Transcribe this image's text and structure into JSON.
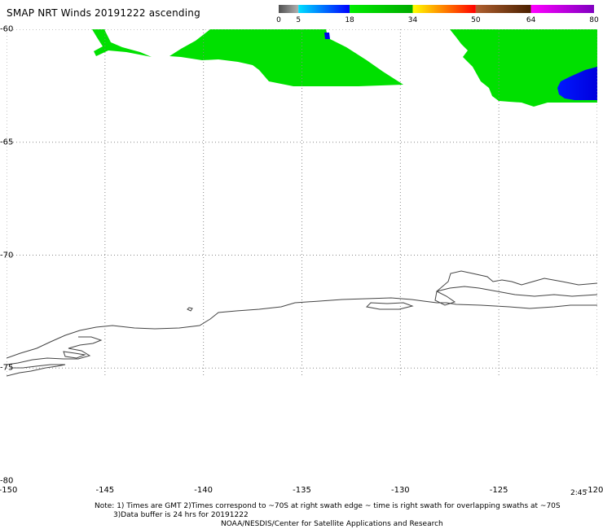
{
  "title": "SMAP NRT Winds 20191222 ascending",
  "legend": {
    "ticks": [
      {
        "label": "0",
        "value": 0
      },
      {
        "label": "5",
        "value": 5
      },
      {
        "label": "18",
        "value": 18
      },
      {
        "label": "34",
        "value": 34
      },
      {
        "label": "50",
        "value": 50
      },
      {
        "label": "64",
        "value": 64
      },
      {
        "label": "80",
        "value": 80
      }
    ],
    "bands": [
      {
        "from": 0,
        "to": 5,
        "colors": [
          "#505050",
          "#b0b0b0"
        ]
      },
      {
        "from": 5,
        "to": 18,
        "colors": [
          "#00e0ff",
          "#0000ff"
        ]
      },
      {
        "from": 18,
        "to": 34,
        "colors": [
          "#00ee00",
          "#00aa00"
        ]
      },
      {
        "from": 34,
        "to": 50,
        "colors": [
          "#ffff00",
          "#ff8000",
          "#ff0000"
        ]
      },
      {
        "from": 50,
        "to": 64,
        "colors": [
          "#b06030",
          "#4a2000"
        ]
      },
      {
        "from": 64,
        "to": 80,
        "colors": [
          "#ff00ff",
          "#8000c0"
        ]
      }
    ]
  },
  "axes": {
    "lat_labels": [
      "-60",
      "-65",
      "-70",
      "-75",
      "-80"
    ],
    "lon_labels": [
      "-150",
      "-145",
      "-140",
      "-135",
      "-130",
      "-125",
      "-120"
    ],
    "lat_range": [
      -80,
      -60
    ],
    "lon_range": [
      -150,
      -120
    ],
    "grid": "dotted"
  },
  "time_label": "2:45",
  "notes": [
    "Note: 1) Times are GMT 2)Times correspond to ~70S at right swath edge ~ time is right swath for overlapping swaths at ~70S",
    "3)Data buffer is 24 hrs for 20191222",
    "NOAA/NESDIS/Center for Satellite Applications and Research"
  ],
  "colors": {
    "wind_green": "#00e000",
    "wind_blue": "#0000ee",
    "coastline": "#444444",
    "grid": "#888888"
  }
}
